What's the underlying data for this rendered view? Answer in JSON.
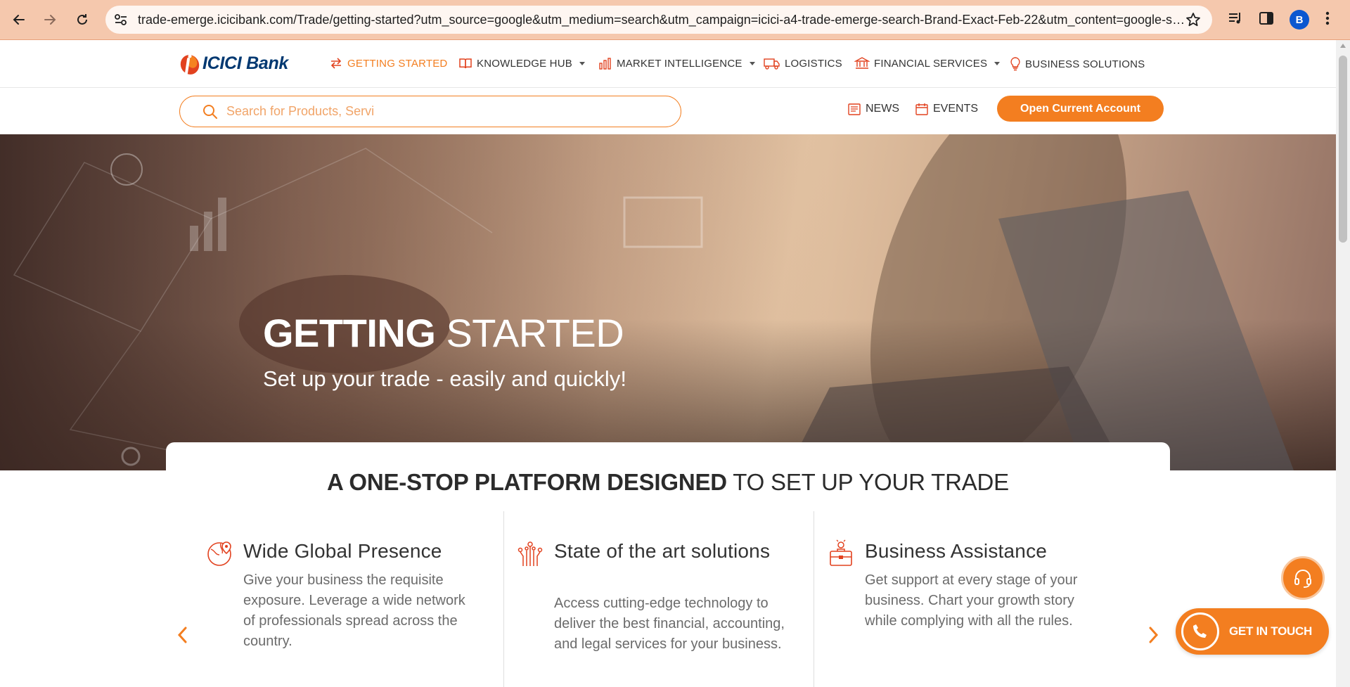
{
  "browser": {
    "url": "trade-emerge.icicibank.com/Trade/getting-started?utm_source=google&utm_medium=search&utm_campaign=icici-a4-trade-emerge-search-Brand-Exact-Feb-22&utm_content=google-sea...",
    "profile_initial": "B"
  },
  "header": {
    "logo_text": "ICICI Bank",
    "menu": [
      {
        "label": "GETTING STARTED",
        "icon": "arrows-exchange-icon",
        "active": true
      },
      {
        "label": "KNOWLEDGE HUB",
        "icon": "book-icon",
        "dropdown": true
      },
      {
        "label": "MARKET INTELLIGENCE",
        "icon": "bar-chart-icon",
        "dropdown": true
      },
      {
        "label": "LOGISTICS",
        "icon": "truck-icon"
      },
      {
        "label": "FINANCIAL SERVICES",
        "icon": "bank-icon",
        "dropdown": true
      },
      {
        "label": "BUSINESS SOLUTIONS",
        "icon": "lightbulb-icon"
      }
    ]
  },
  "subnav": {
    "search_placeholder": "Search for Products, Servi",
    "news_label": "NEWS",
    "events_label": "EVENTS",
    "cta_label": "Open Current Account"
  },
  "hero": {
    "title_bold": "GETTING",
    "title_rest": " STARTED",
    "subtitle": "Set up your trade - easily and quickly!"
  },
  "platform": {
    "title_bold": "A ONE-STOP PLATFORM DESIGNED",
    "title_rest": " TO SET UP YOUR TRADE",
    "features": [
      {
        "title": "Wide Global Presence",
        "body": "Give your business the requisite exposure. Leverage a wide network of professionals spread across the country.",
        "icon": "globe-pin-icon"
      },
      {
        "title": "State of the art solutions",
        "body": "Access cutting-edge technology to deliver the best financial, accounting, and legal services for your business.",
        "icon": "circuit-icon"
      },
      {
        "title": "Business Assistance",
        "body": "Get support at every stage of your business. Chart your growth story while complying with all the rules.",
        "icon": "briefcase-person-icon"
      }
    ]
  },
  "floating": {
    "get_in_touch": "GET IN TOUCH"
  },
  "colors": {
    "brand_orange": "#f37e20",
    "brand_navy": "#003871",
    "chrome_bg": "#f5c8ad"
  }
}
